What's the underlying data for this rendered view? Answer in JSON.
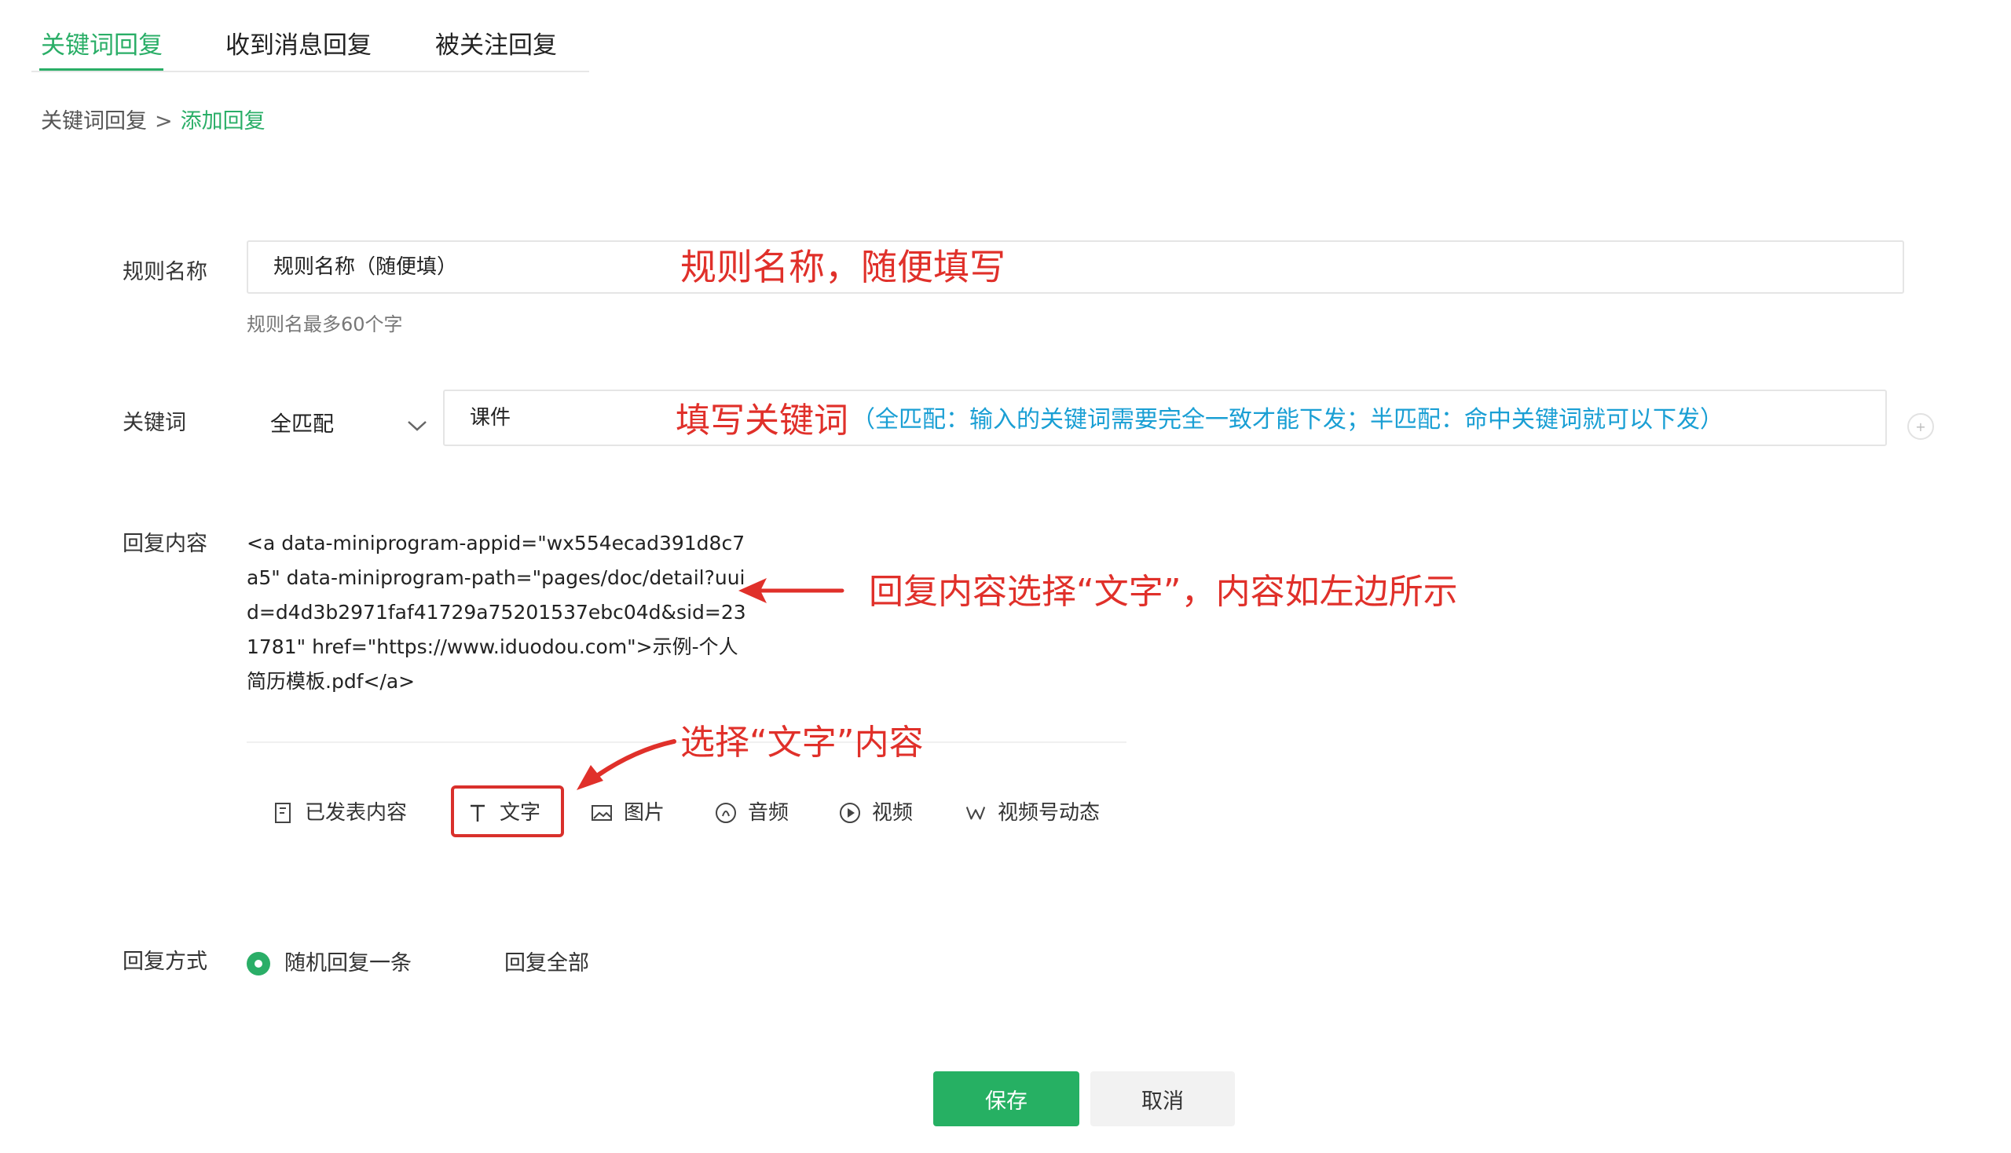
{
  "tabs": [
    {
      "label": "关键词回复",
      "active": true
    },
    {
      "label": "收到消息回复",
      "active": false
    },
    {
      "label": "被关注回复",
      "active": false
    }
  ],
  "breadcrumb": {
    "parent": "关键词回复",
    "separator": ">",
    "current": "添加回复"
  },
  "rule_name": {
    "label": "规则名称",
    "value": "规则名称（随便填）",
    "hint": "规则名最多60个字",
    "annotation": "规则名称，随便填写"
  },
  "keyword": {
    "label": "关键词",
    "match_mode": "全匹配",
    "value": "课件",
    "annotation_red": "填写关键词",
    "annotation_blue": "（全匹配：输入的关键词需要完全一致才能下发；半匹配：命中关键词就可以下发）"
  },
  "reply_content": {
    "label": "回复内容",
    "text": "<a data-miniprogram-appid=\"wx554ecad391d8c7a5\" data-miniprogram-path=\"pages/doc/detail?uuid=d4d3b2971faf41729a75201537ebc04d&sid=231781\" href=\"https://www.iduodou.com\">示例-个人简历模板.pdf</a>",
    "annotation": "回复内容选择“文字”，内容如左边所示"
  },
  "toolbar": {
    "annotation": "选择“文字”内容",
    "items": [
      {
        "label": "已发表内容",
        "icon": "document-icon"
      },
      {
        "label": "文字",
        "icon": "text-icon",
        "selected": true
      },
      {
        "label": "图片",
        "icon": "image-icon"
      },
      {
        "label": "音频",
        "icon": "audio-icon"
      },
      {
        "label": "视频",
        "icon": "video-icon"
      },
      {
        "label": "视频号动态",
        "icon": "channels-icon"
      }
    ]
  },
  "reply_mode": {
    "label": "回复方式",
    "options": [
      {
        "label": "随机回复一条",
        "selected": true
      },
      {
        "label": "回复全部",
        "selected": false
      }
    ]
  },
  "actions": {
    "save": "保存",
    "cancel": "取消"
  },
  "colors": {
    "accent": "#2aae67",
    "annotation_red": "#e0302a",
    "annotation_blue": "#1a9fd4"
  }
}
